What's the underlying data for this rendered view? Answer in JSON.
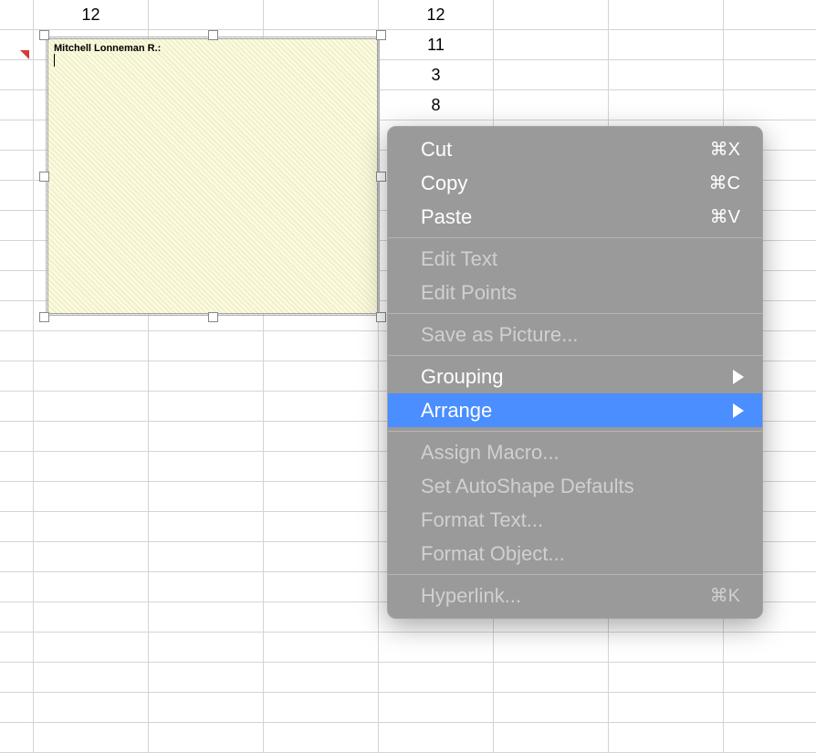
{
  "spreadsheet": {
    "rows": [
      {
        "b": "12",
        "e": "12"
      },
      {
        "e": "11"
      },
      {
        "e": "3"
      },
      {
        "e": "8"
      },
      {},
      {},
      {},
      {},
      {},
      {},
      {},
      {},
      {},
      {},
      {},
      {},
      {},
      {},
      {},
      {},
      {},
      {},
      {},
      {},
      {}
    ]
  },
  "comment": {
    "author_label": "Mitchell Lonneman R.:"
  },
  "context_menu": {
    "items": [
      {
        "label": "Cut",
        "shortcut": "⌘X",
        "enabled": true,
        "type": "item"
      },
      {
        "label": "Copy",
        "shortcut": "⌘C",
        "enabled": true,
        "type": "item"
      },
      {
        "label": "Paste",
        "shortcut": "⌘V",
        "enabled": true,
        "type": "item"
      },
      {
        "type": "separator"
      },
      {
        "label": "Edit Text",
        "enabled": false,
        "type": "item"
      },
      {
        "label": "Edit Points",
        "enabled": false,
        "type": "item"
      },
      {
        "type": "separator"
      },
      {
        "label": "Save as Picture...",
        "enabled": false,
        "type": "item"
      },
      {
        "type": "separator"
      },
      {
        "label": "Grouping",
        "enabled": true,
        "submenu": true,
        "type": "item"
      },
      {
        "label": "Arrange",
        "enabled": true,
        "submenu": true,
        "highlighted": true,
        "type": "item"
      },
      {
        "type": "separator"
      },
      {
        "label": "Assign Macro...",
        "enabled": false,
        "type": "item"
      },
      {
        "label": "Set AutoShape Defaults",
        "enabled": false,
        "type": "item"
      },
      {
        "label": "Format Text...",
        "enabled": false,
        "type": "item"
      },
      {
        "label": "Format Object...",
        "enabled": false,
        "type": "item"
      },
      {
        "type": "separator"
      },
      {
        "label": "Hyperlink...",
        "shortcut": "⌘K",
        "enabled": false,
        "type": "item"
      }
    ]
  }
}
